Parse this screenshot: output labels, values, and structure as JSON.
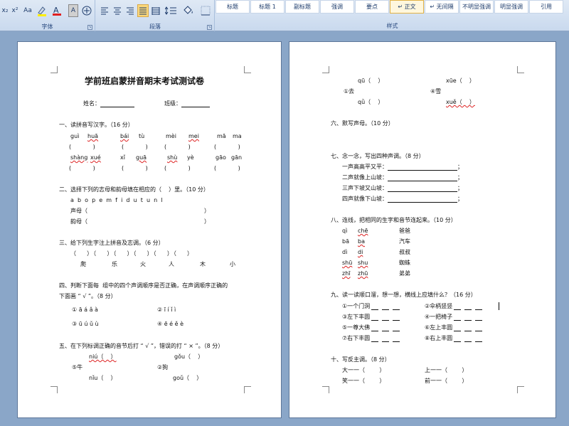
{
  "ribbon": {
    "font_group": {
      "label": "字体",
      "btn_sub": "x₂",
      "btn_sup": "x²",
      "btn_case": "Aa",
      "btn_char": "A"
    },
    "para_group": {
      "label": "段落"
    },
    "styles_group": {
      "label": "样式",
      "tiles": [
        "标题",
        "标题 1",
        "副标题",
        "强调",
        "要点",
        "↵ 正文",
        "↵ 无间隔",
        "不明显强调",
        "明显强调",
        "引用"
      ],
      "active_index": 5
    }
  },
  "page1": {
    "title": "学前班启蒙拼音期末考试测试卷",
    "name_label": "姓名：",
    "class_label": "班级：",
    "s1": {
      "heading": "一、读拼音写汉字。（16 分）",
      "row1": [
        "guì",
        "huā",
        "bái",
        "tù",
        "mèi",
        "mei",
        "mā",
        "ma"
      ],
      "row2": [
        "shàng",
        "xué",
        "xǐ",
        "guā",
        "shù",
        "yè",
        "gāo",
        "gān"
      ],
      "paren": "(            )"
    },
    "s2": {
      "heading": "二、选择下列的志母和韵母填在相应的（    ）里。（10 分）",
      "letters": "a  b  o  p  e  m  f  i  d  u  t  u  n  l",
      "shengmu": "声母（",
      "yunmu": "韵母（",
      "close": "）"
    },
    "s3": {
      "heading": "三、给下列生字注上拼音及志调。（6 分）",
      "parens": "（    ）（    ）（    ）（    ）（    ）（    ）",
      "chars": [
        "爬",
        "乐",
        "火",
        "人",
        "木",
        "小"
      ]
    },
    "s4": {
      "heading1": "四、判断下面每  组中的四个声调顺序是否正确，在声调顺序正确的",
      "heading2": "下面画 “ √ ”。（8 分）",
      "items": [
        "① ā á ǎ à",
        "② ī í ǐ ì",
        "③ ū ú ǔ ù",
        "④ ē é ě è"
      ]
    },
    "s5": {
      "heading": "五、在下列标调正确的音节后打 “ √ ”，错误的打 “ × ”。（8 分）",
      "a": "niú（    ）",
      "b": "gǒu（    ）",
      "c": "⑤牛",
      "d": "②狗",
      "e": "nǐu（    ）",
      "f": "goǔ（    ）"
    }
  },
  "page2": {
    "top": {
      "a": "qū（    ）",
      "b": "xūe（    ）",
      "c": "①去",
      "d": "④雪",
      "e": "qǜ（    ）",
      "f": "xuě（    ）"
    },
    "s6": {
      "heading": "六、默写声母。（10 分）"
    },
    "s7": {
      "heading": "七、念一念，写出四种声调。（8 分）",
      "lines": [
        "一声高高平又平：",
        "二声就像上山坡：",
        "三声下坡又山坡：",
        "四声就像下山坡："
      ],
      "end": "；"
    },
    "s8": {
      "heading": "八、连线，把相同的生字和音节连起来。（10 分）",
      "left": [
        [
          "qì",
          "chē"
        ],
        [
          "bā",
          "ba"
        ],
        [
          "dì",
          "di"
        ],
        [
          "shū",
          "shu"
        ],
        [
          "zhī",
          "zhū"
        ]
      ],
      "right": [
        "爸爸",
        "汽车",
        "叔叔",
        "蜘蛛",
        "弟弟"
      ]
    },
    "s9": {
      "heading": "九、读一读顺口溜，想一想，横线上应填什么？（16 分）",
      "left": [
        "①一个门洞",
        "③左下丰圆",
        "⑤一尊大佛",
        "⑦右下丰圆"
      ],
      "right": [
        "②伞柄竖竖",
        "④一把椅子",
        "⑥左上丰圆",
        "⑧右上丰圆"
      ]
    },
    "s10": {
      "heading": "十、写反主调。（8 分）",
      "items": [
        "大一一（        ）",
        "上一一（        ）",
        "笑一一（        ）",
        "前一一（        ）"
      ]
    }
  }
}
